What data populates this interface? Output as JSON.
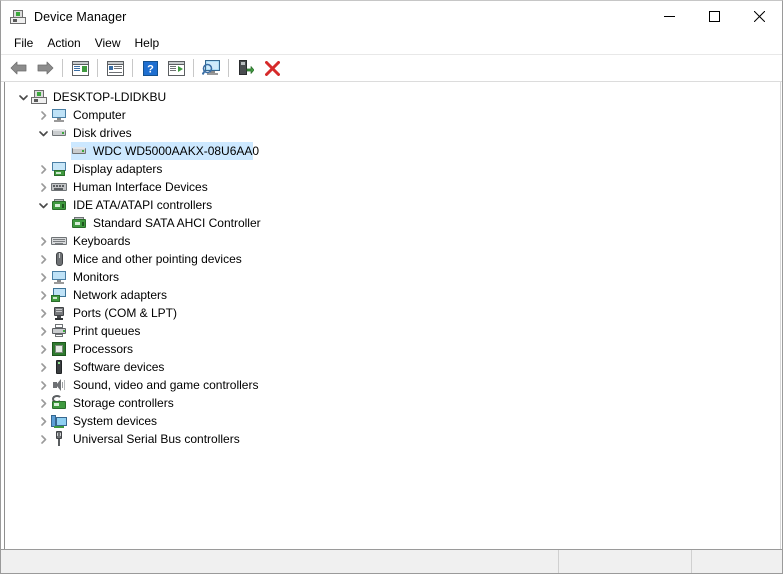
{
  "window": {
    "title": "Device Manager",
    "icon": "device-manager-icon",
    "controls": {
      "minimize": "minimize-button",
      "maximize": "maximize-button",
      "close": "close-button"
    }
  },
  "menubar": {
    "items": [
      {
        "label": "File",
        "name": "menu-file"
      },
      {
        "label": "Action",
        "name": "menu-action"
      },
      {
        "label": "View",
        "name": "menu-view"
      },
      {
        "label": "Help",
        "name": "menu-help"
      }
    ]
  },
  "toolbar": {
    "buttons": [
      {
        "name": "back-button",
        "icon": "back-arrow-icon",
        "tooltip": "Back"
      },
      {
        "name": "forward-button",
        "icon": "forward-arrow-icon",
        "tooltip": "Forward"
      },
      {
        "name": "show-hide-console-tree-button",
        "icon": "console-tree-icon",
        "tooltip": "Show/Hide Console Tree"
      },
      {
        "name": "properties-button",
        "icon": "properties-icon",
        "tooltip": "Properties"
      },
      {
        "name": "help-button",
        "icon": "help-question-icon",
        "tooltip": "Help"
      },
      {
        "name": "update-driver-button",
        "icon": "update-driver-icon",
        "tooltip": "Update Driver Software"
      },
      {
        "name": "scan-hardware-changes-button",
        "icon": "scan-hardware-icon",
        "tooltip": "Scan for hardware changes"
      },
      {
        "name": "enable-device-button",
        "icon": "enable-device-icon",
        "tooltip": "Enable device"
      },
      {
        "name": "uninstall-device-button",
        "icon": "uninstall-red-x-icon",
        "tooltip": "Uninstall device"
      }
    ]
  },
  "tree": {
    "nodes": [
      {
        "label": "DESKTOP-LDIDKBU",
        "depth": 0,
        "state": "expanded",
        "icon": "computer-root-icon",
        "selected": false
      },
      {
        "label": "Computer",
        "depth": 1,
        "state": "collapsed",
        "icon": "monitor-icon",
        "selected": false
      },
      {
        "label": "Disk drives",
        "depth": 1,
        "state": "expanded",
        "icon": "disk-drive-icon",
        "selected": false
      },
      {
        "label": "WDC WD5000AAKX-08U6AA0",
        "depth": 2,
        "state": "leaf",
        "icon": "disk-drive-icon",
        "selected": true
      },
      {
        "label": "Display adapters",
        "depth": 1,
        "state": "collapsed",
        "icon": "display-adapter-icon",
        "selected": false
      },
      {
        "label": "Human Interface Devices",
        "depth": 1,
        "state": "collapsed",
        "icon": "human-interface-device-icon",
        "selected": false
      },
      {
        "label": "IDE ATA/ATAPI controllers",
        "depth": 1,
        "state": "expanded",
        "icon": "ide-controller-icon",
        "selected": false
      },
      {
        "label": "Standard SATA AHCI Controller",
        "depth": 2,
        "state": "leaf",
        "icon": "ide-controller-icon",
        "selected": false
      },
      {
        "label": "Keyboards",
        "depth": 1,
        "state": "collapsed",
        "icon": "keyboard-icon",
        "selected": false
      },
      {
        "label": "Mice and other pointing devices",
        "depth": 1,
        "state": "collapsed",
        "icon": "mouse-icon",
        "selected": false
      },
      {
        "label": "Monitors",
        "depth": 1,
        "state": "collapsed",
        "icon": "monitor-icon",
        "selected": false
      },
      {
        "label": "Network adapters",
        "depth": 1,
        "state": "collapsed",
        "icon": "network-adapter-icon",
        "selected": false
      },
      {
        "label": "Ports (COM & LPT)",
        "depth": 1,
        "state": "collapsed",
        "icon": "port-icon",
        "selected": false
      },
      {
        "label": "Print queues",
        "depth": 1,
        "state": "collapsed",
        "icon": "printer-icon",
        "selected": false
      },
      {
        "label": "Processors",
        "depth": 1,
        "state": "collapsed",
        "icon": "processor-icon",
        "selected": false
      },
      {
        "label": "Software devices",
        "depth": 1,
        "state": "collapsed",
        "icon": "software-device-icon",
        "selected": false
      },
      {
        "label": "Sound, video and game controllers",
        "depth": 1,
        "state": "collapsed",
        "icon": "sound-icon",
        "selected": false
      },
      {
        "label": "Storage controllers",
        "depth": 1,
        "state": "collapsed",
        "icon": "storage-controller-icon",
        "selected": false
      },
      {
        "label": "System devices",
        "depth": 1,
        "state": "collapsed",
        "icon": "system-device-icon",
        "selected": false
      },
      {
        "label": "Universal Serial Bus controllers",
        "depth": 1,
        "state": "collapsed",
        "icon": "usb-icon",
        "selected": false
      }
    ]
  },
  "statusbar": {
    "main": "",
    "second": "",
    "third": ""
  },
  "colors": {
    "selection": "#cce8ff",
    "window_bg": "#ffffff",
    "statusbar_bg": "#f0f0f0",
    "accent_green": "#3f9a3f",
    "accent_red": "#d62a2a",
    "accent_blue": "#1f6fd0"
  }
}
